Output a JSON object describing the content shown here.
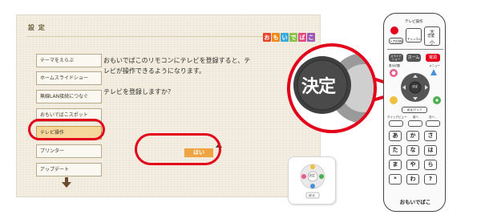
{
  "screen": {
    "title": "設 定",
    "logo_letters": [
      "お",
      "も",
      "い",
      "で",
      "ば",
      "こ"
    ],
    "logo_colors": [
      "#e8452c",
      "#f08a1c",
      "#3aa9e0",
      "#8bc34a",
      "#e3457e",
      "#9c59b6"
    ],
    "menu_items": [
      "テーマをえらぶ",
      "ホームスライドショー",
      "無線LAN接続につなぐ",
      "おもいでばこスポット",
      "テレビ操作",
      "プリンター",
      "アップデート"
    ],
    "selected_menu_index": 4,
    "message_lines": [
      "おもいでばこのリモコンにテレビを登録すると、テ",
      "レビが操作できるようになります。"
    ],
    "question": "テレビを登録しますか？",
    "yes_label": "はい",
    "thumb_center_label": "決定",
    "thumb_return_label": "戻る"
  },
  "callout": {
    "label": "決定"
  },
  "remote": {
    "tv_label": "テレビ操作",
    "power_label": "電源",
    "input_label": "入力切換",
    "volume_label": "大",
    "volume_mid": "音量",
    "volume_small": "小",
    "channel_label": "チャンネル",
    "slideshow_label": "スライドショー",
    "home_label": "ホーム",
    "power2_label": "電源",
    "menu_label": "メニュー",
    "display_label": "表示切替",
    "ok_label": "決定",
    "back_label": "戻る/クリア",
    "quick_label": "クイックビュー",
    "prev_label": "前へ",
    "next_label": "次へ",
    "kana_keys": [
      "あ",
      "か",
      "さ",
      "た",
      "な",
      "は",
      "ま",
      "や",
      "ら",
      "*",
      "わ",
      "?"
    ],
    "brand": "おもいでばこ"
  },
  "colors": {
    "accent_red": "#e2001a",
    "yes_orange": "#f0a342",
    "selected_menu": "#f6d79b"
  }
}
